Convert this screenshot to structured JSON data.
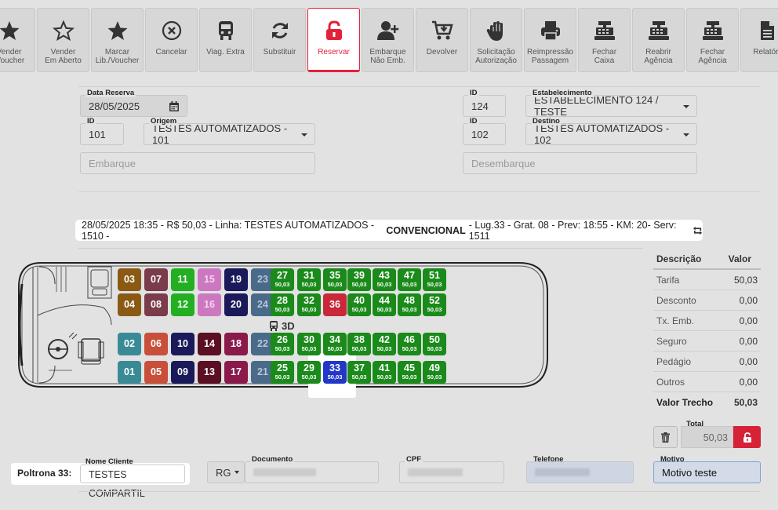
{
  "toolbar": [
    {
      "name": "vender-voucher",
      "label": "Vender\n/Voucher",
      "icon": "star-icon"
    },
    {
      "name": "vender-em-aberto",
      "label": "Vender\nEm Aberto",
      "icon": "star-outline-icon"
    },
    {
      "name": "marcar-lib-voucher",
      "label": "Marcar\nLib./Voucher",
      "icon": "star-icon"
    },
    {
      "name": "cancelar",
      "label": "Cancelar",
      "icon": "x-circle-icon"
    },
    {
      "name": "viag-extra",
      "label": "Viag. Extra",
      "icon": "bus-icon"
    },
    {
      "name": "substituir",
      "label": "Substituir",
      "icon": "refresh-icon"
    },
    {
      "name": "reservar",
      "label": "Reservar",
      "icon": "unlock-icon",
      "active": true
    },
    {
      "name": "embarque-nao-emb",
      "label": "Embarque\nNão Emb.",
      "icon": "user-plus-icon"
    },
    {
      "name": "devolver",
      "label": "Devolver",
      "icon": "cart-down-icon"
    },
    {
      "name": "solicitacao-autorizacao",
      "label": "Solicitação\nAutorização",
      "icon": "hand-icon"
    },
    {
      "name": "reimpressao-passagem",
      "label": "Reimpressão\nPassagem",
      "icon": "printer-icon"
    },
    {
      "name": "fechar-caixa",
      "label": "Fechar\nCaixa",
      "icon": "cash-register-icon"
    },
    {
      "name": "reabrir-agencia",
      "label": "Reabrir\nAgência",
      "icon": "cash-register-icon"
    },
    {
      "name": "fechar-agencia",
      "label": "Fechar\nAgência",
      "icon": "cash-register-icon"
    },
    {
      "name": "relatorios",
      "label": "Relatóri",
      "icon": "document-icon"
    }
  ],
  "form": {
    "data_reserva_label": "Data Reserva",
    "data_reserva": "28/05/2025",
    "id_label": "ID",
    "origem_id": "101",
    "origem_label": "Origem",
    "origem": "TESTES AUTOMATIZADOS - 101",
    "embarque_placeholder": "Embarque",
    "estab_id": "124",
    "estab_label": "Estabelecimento",
    "estab": "ESTABELECIMENTO 124 / TESTE",
    "destino_id": "102",
    "destino_label": "Destino",
    "destino": "TESTES AUTOMATIZADOS - 102",
    "desembarque_placeholder": "Desembarque"
  },
  "trip": {
    "prefix": "28/05/2025 18:35 - R$ 50,03 - Linha: TESTES AUTOMATIZADOS - 1510 -",
    "class": "CONVENCIONAL",
    "suffix": "- Lug.33 - Grat. 08 - Prev: 18:55 - KM: 20- Serv: 1511"
  },
  "bus": {
    "label_3d": "3D",
    "price": "50,03",
    "colors": {
      "free": "#1a8a1a",
      "brown": "#8a5a14",
      "plum": "#7a3b4a",
      "lime": "#22b022",
      "pink": "#cc78c0",
      "navy": "#1a1a5a",
      "slate": "#4a6a8a",
      "teal": "#3a8a96",
      "rust": "#c8503a",
      "maroon": "#5a0f22",
      "magenta": "#8a1a4a",
      "red": "#c8283a",
      "selected": "#2236c8"
    },
    "rows": [
      [
        {
          "n": "03",
          "c": "brown"
        },
        {
          "n": "07",
          "c": "plum"
        },
        {
          "n": "11",
          "c": "lime"
        },
        {
          "n": "15",
          "c": "pink"
        },
        {
          "n": "19",
          "c": "navy"
        },
        {
          "n": "23",
          "c": "slate"
        },
        {
          "n": "27",
          "c": "free",
          "p": 1
        },
        {
          "n": "31",
          "c": "free",
          "p": 1
        },
        {
          "n": "35",
          "c": "free",
          "p": 1
        },
        {
          "n": "39",
          "c": "free",
          "p": 1
        },
        {
          "n": "43",
          "c": "free",
          "p": 1
        },
        {
          "n": "47",
          "c": "free",
          "p": 1
        },
        {
          "n": "51",
          "c": "free",
          "p": 1
        }
      ],
      [
        {
          "n": "04",
          "c": "brown"
        },
        {
          "n": "08",
          "c": "plum"
        },
        {
          "n": "12",
          "c": "lime"
        },
        {
          "n": "16",
          "c": "pink"
        },
        {
          "n": "20",
          "c": "navy"
        },
        {
          "n": "24",
          "c": "slate"
        },
        {
          "n": "28",
          "c": "free",
          "p": 1
        },
        {
          "n": "32",
          "c": "free",
          "p": 1
        },
        {
          "n": "36",
          "c": "red"
        },
        {
          "n": "40",
          "c": "free",
          "p": 1
        },
        {
          "n": "44",
          "c": "free",
          "p": 1
        },
        {
          "n": "48",
          "c": "free",
          "p": 1
        },
        {
          "n": "52",
          "c": "free",
          "p": 1
        }
      ],
      [
        {
          "n": "02",
          "c": "teal"
        },
        {
          "n": "06",
          "c": "rust"
        },
        {
          "n": "10",
          "c": "navy"
        },
        {
          "n": "14",
          "c": "maroon"
        },
        {
          "n": "18",
          "c": "magenta"
        },
        {
          "n": "22",
          "c": "slate"
        },
        {
          "n": "26",
          "c": "free",
          "p": 1
        },
        {
          "n": "30",
          "c": "free",
          "p": 1
        },
        {
          "n": "34",
          "c": "free",
          "p": 1
        },
        {
          "n": "38",
          "c": "free",
          "p": 1
        },
        {
          "n": "42",
          "c": "free",
          "p": 1
        },
        {
          "n": "46",
          "c": "free",
          "p": 1
        },
        {
          "n": "50",
          "c": "free",
          "p": 1
        }
      ],
      [
        {
          "n": "01",
          "c": "teal"
        },
        {
          "n": "05",
          "c": "rust"
        },
        {
          "n": "09",
          "c": "navy"
        },
        {
          "n": "13",
          "c": "maroon"
        },
        {
          "n": "17",
          "c": "magenta"
        },
        {
          "n": "21",
          "c": "slate"
        },
        {
          "n": "25",
          "c": "free",
          "p": 1
        },
        {
          "n": "29",
          "c": "free",
          "p": 1
        },
        {
          "n": "33",
          "c": "selected",
          "p": 1
        },
        {
          "n": "37",
          "c": "free",
          "p": 1
        },
        {
          "n": "41",
          "c": "free",
          "p": 1
        },
        {
          "n": "45",
          "c": "free",
          "p": 1
        },
        {
          "n": "49",
          "c": "free",
          "p": 1
        }
      ]
    ]
  },
  "prices": {
    "h_desc": "Descrição",
    "h_val": "Valor",
    "rows": [
      {
        "d": "Tarifa",
        "v": "50,03"
      },
      {
        "d": "Desconto",
        "v": "0,00"
      },
      {
        "d": "Tx. Emb.",
        "v": "0,00"
      },
      {
        "d": "Seguro",
        "v": "0,00"
      },
      {
        "d": "Pedágio",
        "v": "0,00"
      },
      {
        "d": "Outros",
        "v": "0,00"
      }
    ],
    "total_label": "Valor Trecho",
    "total_value": "50,03",
    "total_field_label": "Total",
    "total_field": "50,03"
  },
  "passenger": {
    "poltrona": "Poltrona 33:",
    "nome_label": "Nome Cliente",
    "nome": "TESTES COMPARTIL",
    "doc_type": "RG",
    "documento_label": "Documento",
    "cpf_label": "CPF",
    "telefone_label": "Telefone",
    "motivo_label": "Motivo",
    "motivo": "Motivo teste"
  }
}
